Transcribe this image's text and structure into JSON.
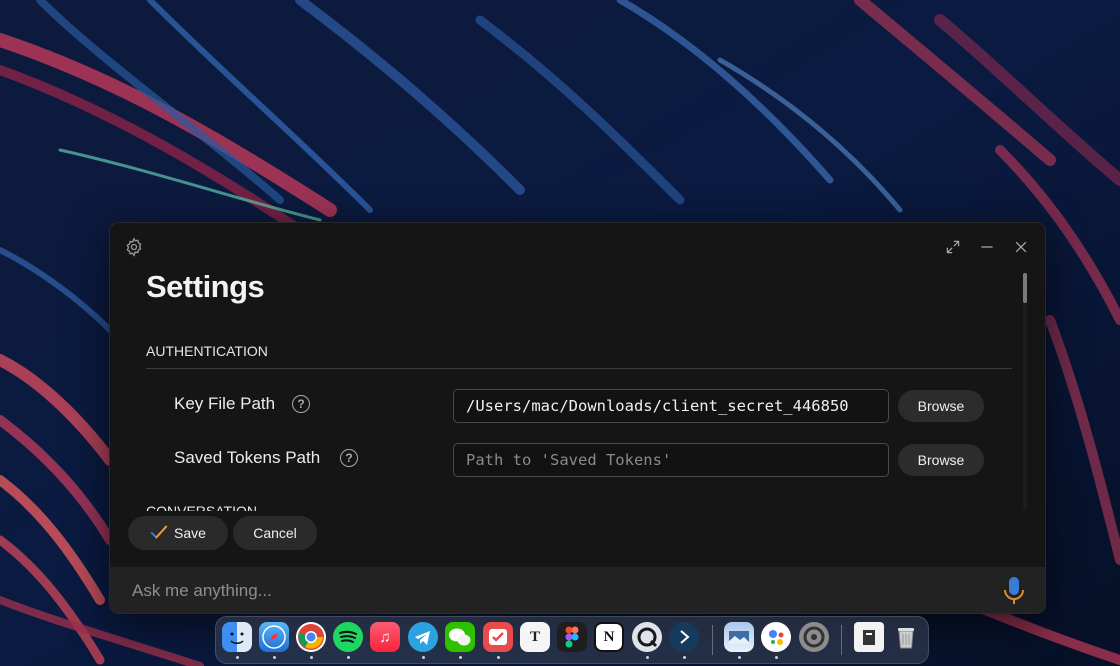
{
  "window": {
    "title": "Settings",
    "controls": {
      "expand": "expand-icon",
      "minimize": "minimize-icon",
      "close": "close-icon"
    }
  },
  "sections": {
    "authentication": "AUTHENTICATION",
    "conversation": "CONVERSATION"
  },
  "fields": {
    "key_file": {
      "label": "Key File Path",
      "value": "/Users/mac/Downloads/client_secret_446850",
      "browse": "Browse"
    },
    "saved_tokens": {
      "label": "Saved Tokens Path",
      "placeholder": "Path to 'Saved Tokens'",
      "browse": "Browse"
    }
  },
  "actions": {
    "save": "Save",
    "cancel": "Cancel"
  },
  "ask": {
    "placeholder": "Ask me anything..."
  },
  "colors": {
    "accent_check": "#f0a020",
    "mic": "#3a7bd5",
    "window_bg": "#151515"
  },
  "dock": {
    "apps": [
      "finder",
      "safari",
      "chrome",
      "spotify",
      "music",
      "telegram",
      "wechat",
      "ticktick",
      "typora",
      "figma",
      "notion",
      "quicktime",
      "prompt",
      "preview",
      "google-assistant",
      "system-preferences",
      "file",
      "trash"
    ]
  }
}
